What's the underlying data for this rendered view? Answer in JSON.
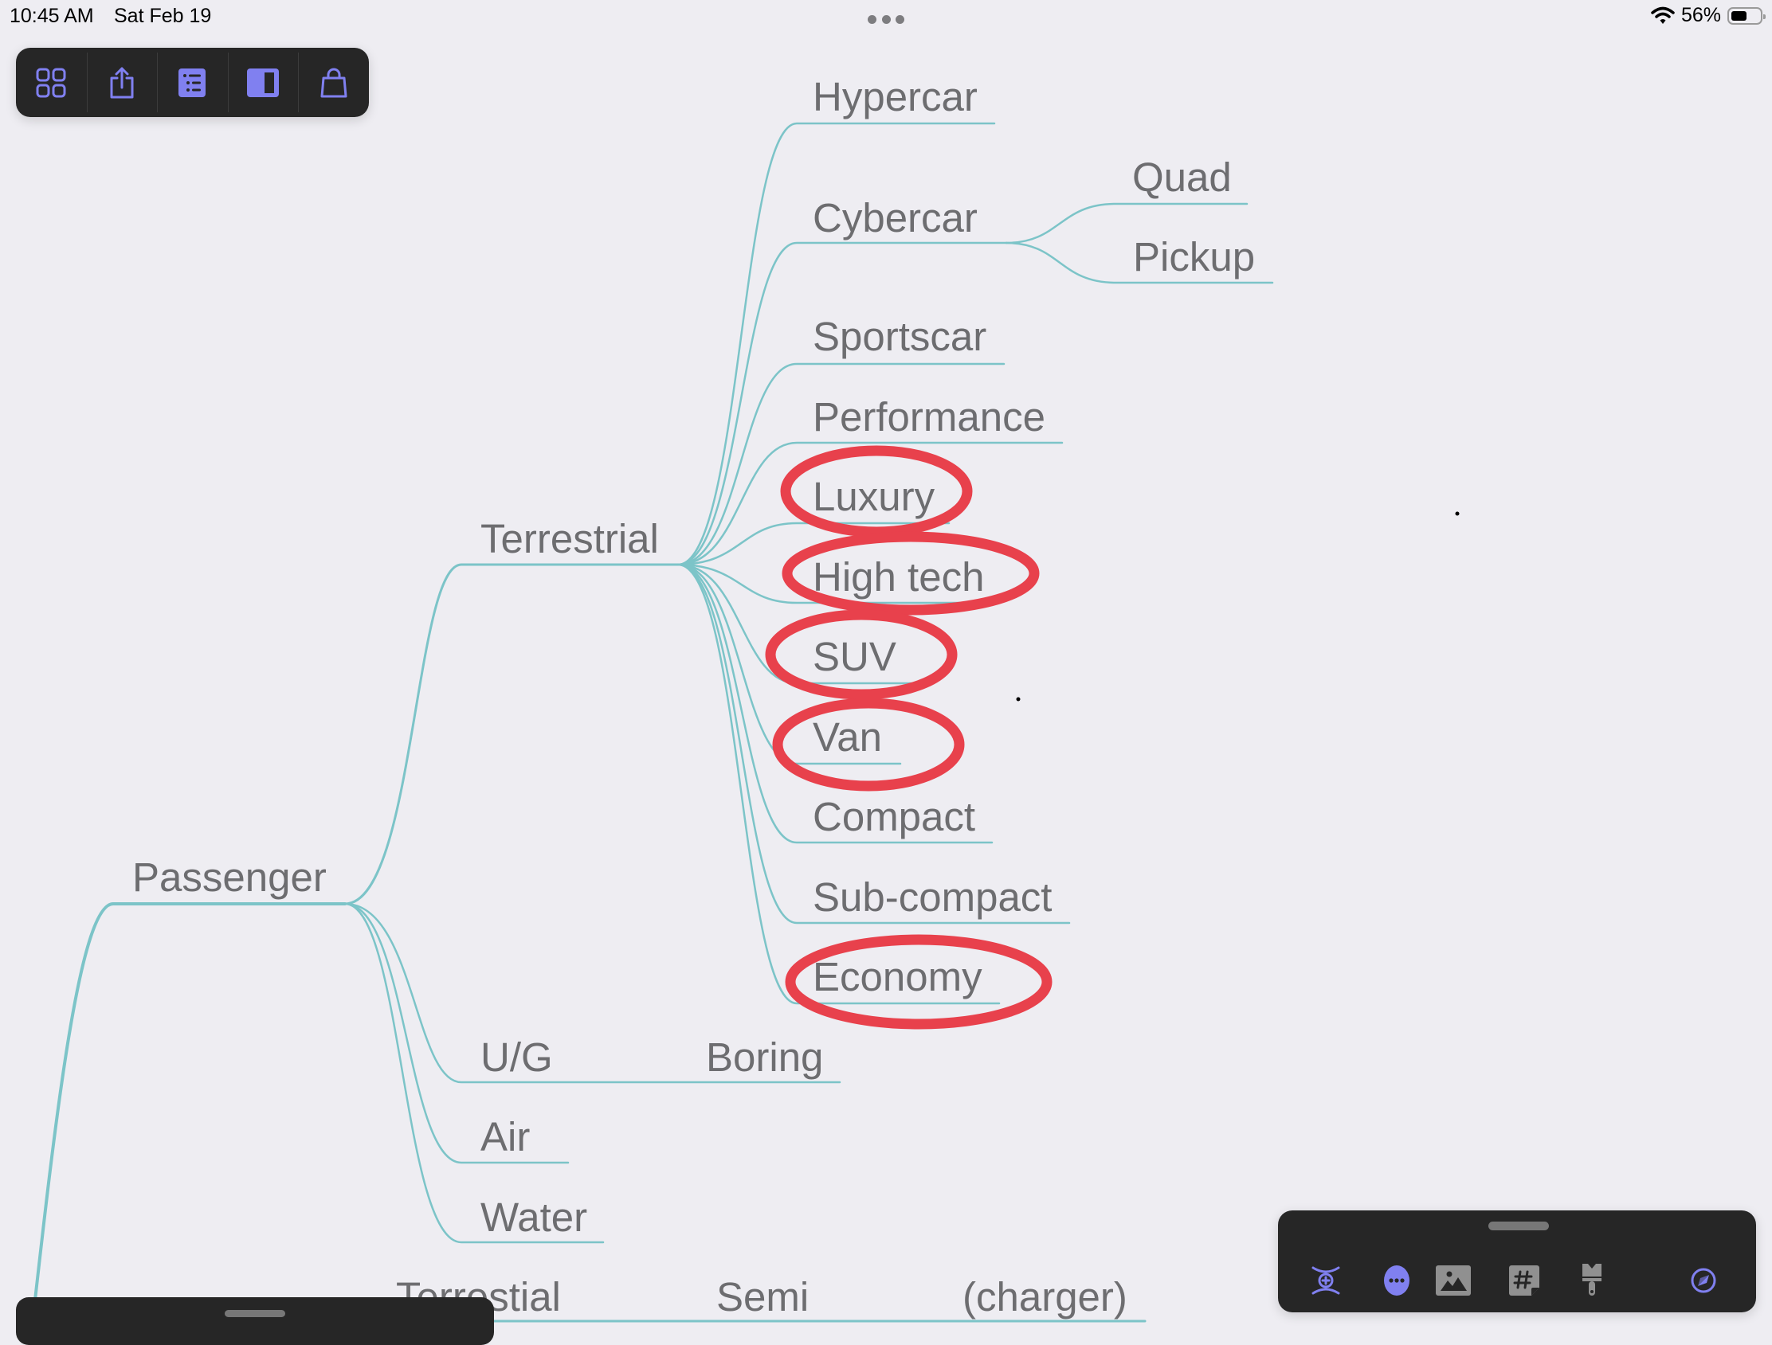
{
  "status_bar": {
    "time": "10:45 AM",
    "date": "Sat Feb 19",
    "battery_percent_label": "56%",
    "battery_level": 0.56,
    "wifi_icon": "wifi-icon",
    "multitasking_icon": "more-dots-icon"
  },
  "top_toolbar": {
    "buttons": [
      {
        "name": "browser-grid",
        "icon": "grid-icon"
      },
      {
        "name": "share",
        "icon": "share-icon"
      },
      {
        "name": "outline",
        "icon": "list-icon"
      },
      {
        "name": "sidebar",
        "icon": "sidebar-panel-icon"
      },
      {
        "name": "store",
        "icon": "shopping-bag-icon"
      }
    ],
    "accent_color": "#8080f0"
  },
  "mindmap": {
    "line_color": "#7cc4c8",
    "text_color": "#6d6d70",
    "highlight_color": "#e8414c",
    "nodes": {
      "passenger": "Passenger",
      "terrestrial": "Terrestrial",
      "hypercar": "Hypercar",
      "cybercar": "Cybercar",
      "quad": "Quad",
      "pickup": "Pickup",
      "sportscar": "Sportscar",
      "performance": "Performance",
      "luxury": "Luxury",
      "high_tech": "High tech",
      "suv": "SUV",
      "van": "Van",
      "compact": "Compact",
      "sub_compact": "Sub-compact",
      "economy": "Economy",
      "ug": "U/G",
      "boring": "Boring",
      "air": "Air",
      "water": "Water",
      "terrestial_2": "Terrestial",
      "semi": "Semi",
      "charger": "(charger)"
    },
    "circled_nodes": [
      "Luxury",
      "High tech",
      "SUV",
      "Van",
      "Economy"
    ]
  },
  "bottom_toolbar": {
    "buttons": [
      {
        "name": "add-node",
        "icon": "add-connection-icon",
        "active": true
      },
      {
        "name": "more",
        "icon": "ellipsis-circle-icon",
        "active": true
      },
      {
        "name": "image",
        "icon": "image-icon",
        "active": false
      },
      {
        "name": "tag",
        "icon": "hashtag-icon",
        "active": false
      },
      {
        "name": "style",
        "icon": "paintbrush-icon",
        "active": false
      },
      {
        "name": "focus",
        "icon": "compass-icon",
        "active": true
      }
    ]
  }
}
